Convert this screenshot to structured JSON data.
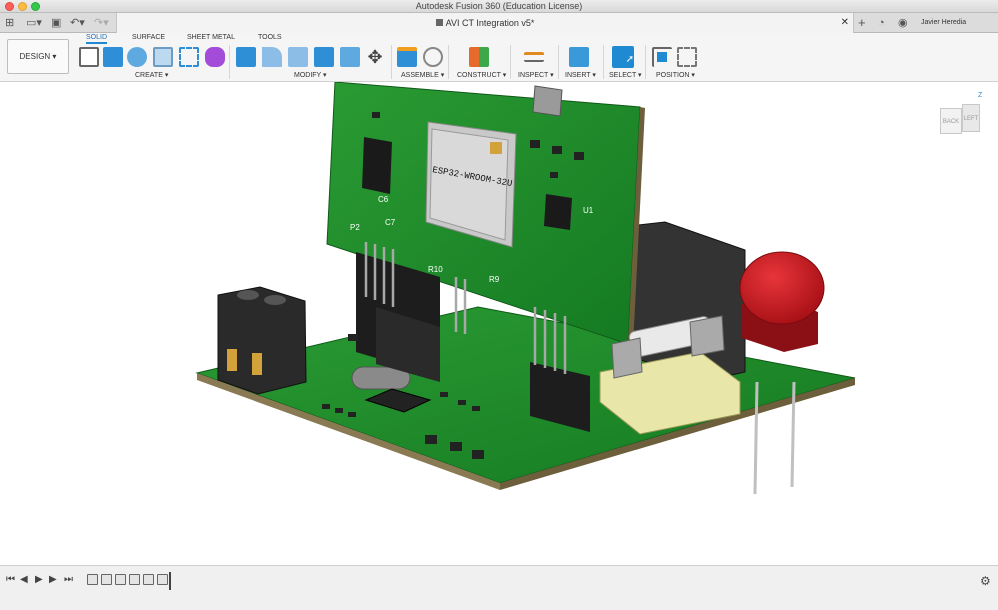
{
  "window": {
    "title": "Autodesk Fusion 360 (Education License)"
  },
  "tabbar": {
    "document_title": "AVI CT Integration v5*",
    "user_name": "Javier Heredia"
  },
  "ribbon": {
    "workspace_label": "DESIGN",
    "tabs": [
      "SOLID",
      "SURFACE",
      "SHEET METAL",
      "TOOLS"
    ],
    "groups": {
      "create": "CREATE",
      "modify": "MODIFY",
      "assemble": "ASSEMBLE",
      "construct": "CONSTRUCT",
      "inspect": "INSPECT",
      "insert": "INSERT",
      "select": "SELECT",
      "position": "POSITION"
    }
  },
  "viewcube": {
    "top": "Z",
    "front": "BACK",
    "left": "LEFT"
  },
  "model": {
    "module_label": "ESP32-WROOM-32U",
    "ref": {
      "p2": "P2",
      "c6": "C6",
      "c7": "C7",
      "u1": "U1",
      "r9": "R9",
      "r10": "R10"
    }
  },
  "colors": {
    "pcb": "#1e8a2a",
    "accent": "#1f8ad1",
    "button_red": "#c4141b"
  }
}
